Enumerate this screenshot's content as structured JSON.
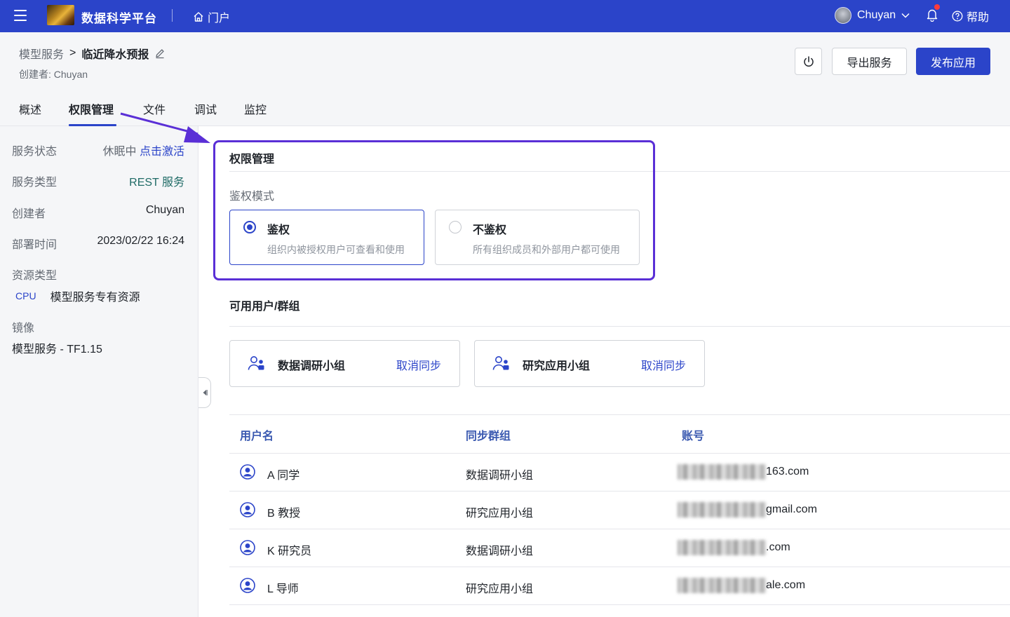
{
  "topbar": {
    "app_title": "数据科学平台",
    "portal_label": "门户",
    "user_name": "Chuyan",
    "help_label": "帮助",
    "brand_color": "#2b44c9"
  },
  "header": {
    "breadcrumb_parent": "模型服务",
    "breadcrumb_sep": ">",
    "breadcrumb_current": "临近降水预报",
    "creator_line": "创建者: Chuyan",
    "export_label": "导出服务",
    "publish_label": "发布应用"
  },
  "tabs": [
    {
      "label": "概述"
    },
    {
      "label": "权限管理",
      "active": true
    },
    {
      "label": "文件"
    },
    {
      "label": "调试"
    },
    {
      "label": "监控"
    }
  ],
  "sidebar": {
    "status_label": "服务状态",
    "status_value": "休眠中",
    "activate_label": "点击激活",
    "type_label": "服务类型",
    "type_value": "REST 服务",
    "creator_label": "创建者",
    "creator_value": "Chuyan",
    "deploy_label": "部署时间",
    "deploy_value": "2023/02/22 16:24",
    "resource_label": "资源类型",
    "resource_tag": "CPU",
    "resource_value": "模型服务专有资源",
    "image_label": "镜像",
    "image_value": "模型服务 - TF1.15"
  },
  "permission": {
    "title": "权限管理",
    "auth_mode_label": "鉴权模式",
    "options": [
      {
        "title": "鉴权",
        "desc": "组织内被授权用户可查看和使用",
        "selected": true
      },
      {
        "title": "不鉴权",
        "desc": "所有组织成员和外部用户都可使用",
        "selected": false
      }
    ]
  },
  "groups": {
    "title": "可用用户/群组",
    "items": [
      {
        "name": "数据调研小组",
        "action": "取消同步"
      },
      {
        "name": "研究应用小组",
        "action": "取消同步"
      }
    ]
  },
  "table": {
    "headers": [
      "用户名",
      "同步群组",
      "账号"
    ],
    "rows": [
      {
        "user": "A 同学",
        "group": "数据调研小组",
        "account_visible": "163.com"
      },
      {
        "user": "B 教授",
        "group": "研究应用小组",
        "account_visible": "gmail.com"
      },
      {
        "user": "K 研究员",
        "group": "数据调研小组",
        "account_visible": ".com"
      },
      {
        "user": "L 导师",
        "group": "研究应用小组",
        "account_visible": "ale.com"
      }
    ]
  }
}
